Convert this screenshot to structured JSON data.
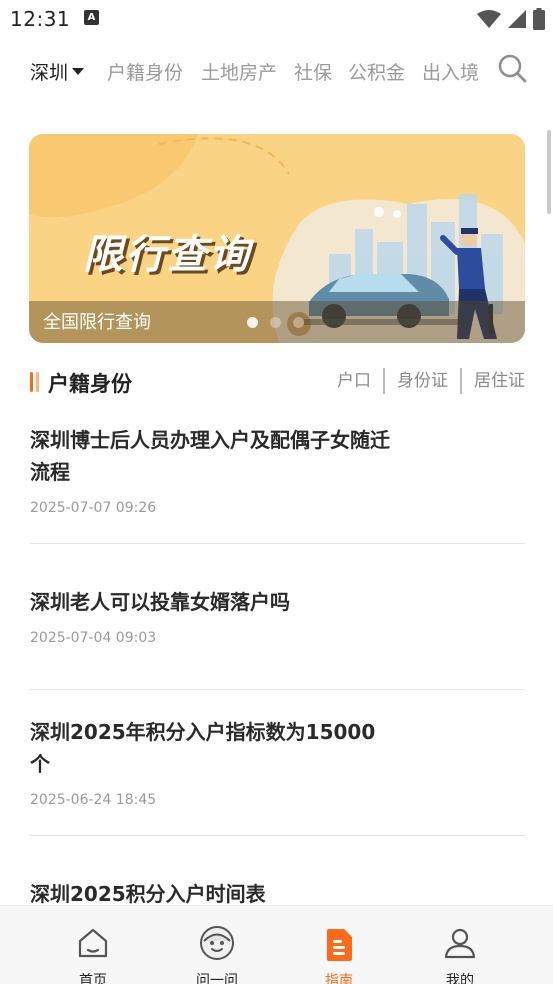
{
  "status_bar": {
    "time": "12:31",
    "badge": "A"
  },
  "top_nav": {
    "city": "深圳",
    "tabs": [
      "户籍身份",
      "土地房产",
      "社保",
      "公积金",
      "出入境"
    ]
  },
  "banner": {
    "headline": "限行查询",
    "caption": "全国限行查询",
    "slide_count": 3,
    "active_slide": 1
  },
  "section": {
    "title": "户籍身份",
    "sub_tabs": [
      "户口",
      "身份证",
      "居住证"
    ]
  },
  "articles": [
    {
      "title": "深圳博士后人员办理入户及配偶子女随迁流程",
      "date": "2025-07-07 09:26"
    },
    {
      "title": "深圳老人可以投靠女婿落户吗",
      "date": "2025-07-04 09:03"
    },
    {
      "title": "深圳2025年积分入户指标数为15000个",
      "date": "2025-06-24 18:45"
    },
    {
      "title": "深圳2025积分入户时间表",
      "date": ""
    }
  ],
  "bottom_nav": {
    "items": [
      {
        "label": "首页",
        "icon": "home-icon"
      },
      {
        "label": "问一问",
        "icon": "chatbot-icon"
      },
      {
        "label": "指南",
        "icon": "guide-icon"
      },
      {
        "label": "我的",
        "icon": "profile-icon"
      }
    ],
    "active": "指南"
  },
  "colors": {
    "accent": "#ff6a1a",
    "banner_bg": "#fbd385",
    "text_primary": "#222222",
    "text_muted": "#9b9b9b"
  }
}
